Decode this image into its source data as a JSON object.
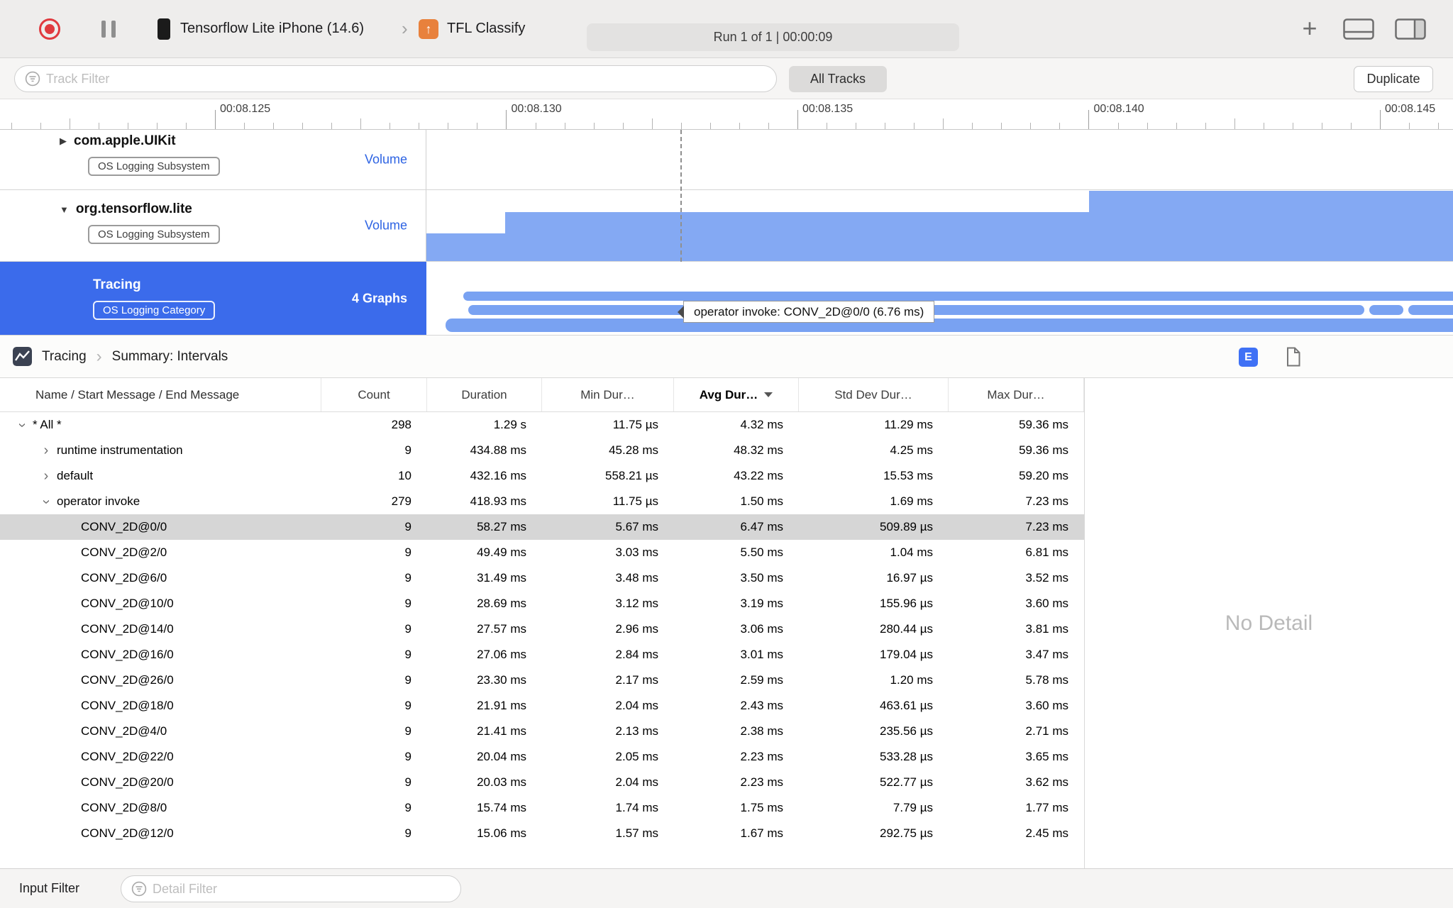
{
  "colors": {
    "accent_blue": "#3b6beb",
    "graph_area_blue": "#84a9f3",
    "graph_bar_blue": "#79a2f2",
    "record_red": "#e03a3f",
    "selected_row_gray": "#d6d6d6"
  },
  "toolbar": {
    "device_name": "Tensorflow Lite iPhone (14.6)",
    "app_name": "TFL Classify",
    "run_status": "Run 1 of 1  |  00:00:09"
  },
  "filter_bar": {
    "track_filter_placeholder": "Track Filter",
    "all_tracks": "All Tracks",
    "duplicate": "Duplicate"
  },
  "ruler": {
    "labels": [
      "00:08.125",
      "00:08.130",
      "00:08.135",
      "00:08.140",
      "00:08.145"
    ]
  },
  "tracks": [
    {
      "name": "com.apple.UIKit",
      "badge": "OS Logging Subsystem",
      "meta": "Volume"
    },
    {
      "name": "org.tensorflow.lite",
      "badge": "OS Logging Subsystem",
      "meta": "Volume"
    },
    {
      "name": "Tracing",
      "badge": "OS Logging Category",
      "meta": "4 Graphs"
    }
  ],
  "timeline": {
    "tooltip": "operator invoke: CONV_2D@0/0 (6.76 ms)"
  },
  "detail": {
    "breadcrumb": {
      "instrument": "Tracing",
      "page": "Summary: Intervals"
    },
    "extended_detail_button": "E",
    "no_detail": "No Detail",
    "table": {
      "columns": [
        "Name / Start Message / End Message",
        "Count",
        "Duration",
        "Min Dur…",
        "Avg Dur…",
        "Std Dev Dur…",
        "Max Dur…"
      ],
      "sort_column": "Avg Dur…",
      "rows": [
        {
          "name": "* All *",
          "level": 0,
          "disclosure": "expanded",
          "count": "298",
          "duration": "1.29 s",
          "min": "11.75 µs",
          "avg": "4.32 ms",
          "std_dev": "11.29 ms",
          "max": "59.36 ms",
          "selected": false
        },
        {
          "name": "runtime instrumentation",
          "level": 1,
          "disclosure": "collapsed",
          "count": "9",
          "duration": "434.88 ms",
          "min": "45.28 ms",
          "avg": "48.32 ms",
          "std_dev": "4.25 ms",
          "max": "59.36 ms",
          "selected": false
        },
        {
          "name": "default",
          "level": 1,
          "disclosure": "collapsed",
          "count": "10",
          "duration": "432.16 ms",
          "min": "558.21 µs",
          "avg": "43.22 ms",
          "std_dev": "15.53 ms",
          "max": "59.20 ms",
          "selected": false
        },
        {
          "name": "operator invoke",
          "level": 1,
          "disclosure": "expanded",
          "count": "279",
          "duration": "418.93 ms",
          "min": "11.75 µs",
          "avg": "1.50 ms",
          "std_dev": "1.69 ms",
          "max": "7.23 ms",
          "selected": false
        },
        {
          "name": "CONV_2D@0/0",
          "level": 2,
          "disclosure": null,
          "count": "9",
          "duration": "58.27 ms",
          "min": "5.67 ms",
          "avg": "6.47 ms",
          "std_dev": "509.89 µs",
          "max": "7.23 ms",
          "selected": true
        },
        {
          "name": "CONV_2D@2/0",
          "level": 2,
          "disclosure": null,
          "count": "9",
          "duration": "49.49 ms",
          "min": "3.03 ms",
          "avg": "5.50 ms",
          "std_dev": "1.04 ms",
          "max": "6.81 ms",
          "selected": false
        },
        {
          "name": "CONV_2D@6/0",
          "level": 2,
          "disclosure": null,
          "count": "9",
          "duration": "31.49 ms",
          "min": "3.48 ms",
          "avg": "3.50 ms",
          "std_dev": "16.97 µs",
          "max": "3.52 ms",
          "selected": false
        },
        {
          "name": "CONV_2D@10/0",
          "level": 2,
          "disclosure": null,
          "count": "9",
          "duration": "28.69 ms",
          "min": "3.12 ms",
          "avg": "3.19 ms",
          "std_dev": "155.96 µs",
          "max": "3.60 ms",
          "selected": false
        },
        {
          "name": "CONV_2D@14/0",
          "level": 2,
          "disclosure": null,
          "count": "9",
          "duration": "27.57 ms",
          "min": "2.96 ms",
          "avg": "3.06 ms",
          "std_dev": "280.44 µs",
          "max": "3.81 ms",
          "selected": false
        },
        {
          "name": "CONV_2D@16/0",
          "level": 2,
          "disclosure": null,
          "count": "9",
          "duration": "27.06 ms",
          "min": "2.84 ms",
          "avg": "3.01 ms",
          "std_dev": "179.04 µs",
          "max": "3.47 ms",
          "selected": false
        },
        {
          "name": "CONV_2D@26/0",
          "level": 2,
          "disclosure": null,
          "count": "9",
          "duration": "23.30 ms",
          "min": "2.17 ms",
          "avg": "2.59 ms",
          "std_dev": "1.20 ms",
          "max": "5.78 ms",
          "selected": false
        },
        {
          "name": "CONV_2D@18/0",
          "level": 2,
          "disclosure": null,
          "count": "9",
          "duration": "21.91 ms",
          "min": "2.04 ms",
          "avg": "2.43 ms",
          "std_dev": "463.61 µs",
          "max": "3.60 ms",
          "selected": false
        },
        {
          "name": "CONV_2D@4/0",
          "level": 2,
          "disclosure": null,
          "count": "9",
          "duration": "21.41 ms",
          "min": "2.13 ms",
          "avg": "2.38 ms",
          "std_dev": "235.56 µs",
          "max": "2.71 ms",
          "selected": false
        },
        {
          "name": "CONV_2D@22/0",
          "level": 2,
          "disclosure": null,
          "count": "9",
          "duration": "20.04 ms",
          "min": "2.05 ms",
          "avg": "2.23 ms",
          "std_dev": "533.28 µs",
          "max": "3.65 ms",
          "selected": false
        },
        {
          "name": "CONV_2D@20/0",
          "level": 2,
          "disclosure": null,
          "count": "9",
          "duration": "20.03 ms",
          "min": "2.04 ms",
          "avg": "2.23 ms",
          "std_dev": "522.77 µs",
          "max": "3.62 ms",
          "selected": false
        },
        {
          "name": "CONV_2D@8/0",
          "level": 2,
          "disclosure": null,
          "count": "9",
          "duration": "15.74 ms",
          "min": "1.74 ms",
          "avg": "1.75 ms",
          "std_dev": "7.79 µs",
          "max": "1.77 ms",
          "selected": false
        },
        {
          "name": "CONV_2D@12/0",
          "level": 2,
          "disclosure": null,
          "count": "9",
          "duration": "15.06 ms",
          "min": "1.57 ms",
          "avg": "1.67 ms",
          "std_dev": "292.75 µs",
          "max": "2.45 ms",
          "selected": false
        }
      ]
    }
  },
  "bottom_bar": {
    "input_filter": "Input Filter",
    "detail_filter_placeholder": "Detail Filter"
  }
}
